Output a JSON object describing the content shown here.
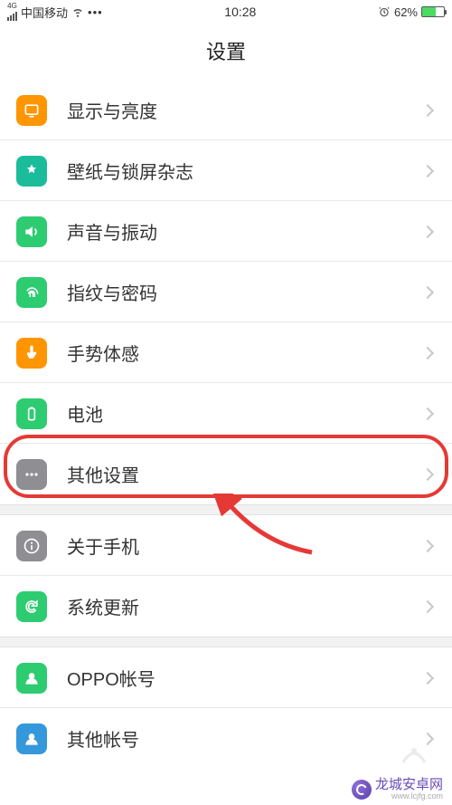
{
  "status": {
    "signal_label": "4G",
    "carrier": "中国移动",
    "time": "10:28",
    "battery_percent": "62%"
  },
  "header": {
    "title": "设置"
  },
  "sections": [
    [
      {
        "id": "display",
        "label": "显示与亮度",
        "icon": "display-icon",
        "color": "#ff9500"
      },
      {
        "id": "wallpaper",
        "label": "壁纸与锁屏杂志",
        "icon": "wallpaper-icon",
        "color": "#1abc9c"
      },
      {
        "id": "sound",
        "label": "声音与振动",
        "icon": "sound-icon",
        "color": "#2ecc71"
      },
      {
        "id": "fingerprint",
        "label": "指纹与密码",
        "icon": "fingerprint-icon",
        "color": "#2ecc71"
      },
      {
        "id": "gesture",
        "label": "手势体感",
        "icon": "gesture-icon",
        "color": "#ff9500"
      },
      {
        "id": "battery",
        "label": "电池",
        "icon": "battery-icon",
        "color": "#2ecc71"
      },
      {
        "id": "other",
        "label": "其他设置",
        "icon": "other-icon",
        "color": "#8e8e93"
      }
    ],
    [
      {
        "id": "about",
        "label": "关于手机",
        "icon": "about-icon",
        "color": "#8e8e93"
      },
      {
        "id": "update",
        "label": "系统更新",
        "icon": "update-icon",
        "color": "#2ecc71"
      }
    ],
    [
      {
        "id": "oppo",
        "label": "OPPO帐号",
        "icon": "oppo-account-icon",
        "color": "#2ecc71"
      },
      {
        "id": "other-acct",
        "label": "其他帐号",
        "icon": "other-account-icon",
        "color": "#3498db"
      }
    ]
  ],
  "annotation": {
    "highlighted_item_id": "other",
    "highlight_color": "#e53935"
  },
  "watermark": {
    "text": "龙城安卓网",
    "url": "www.lcjfg.com"
  }
}
